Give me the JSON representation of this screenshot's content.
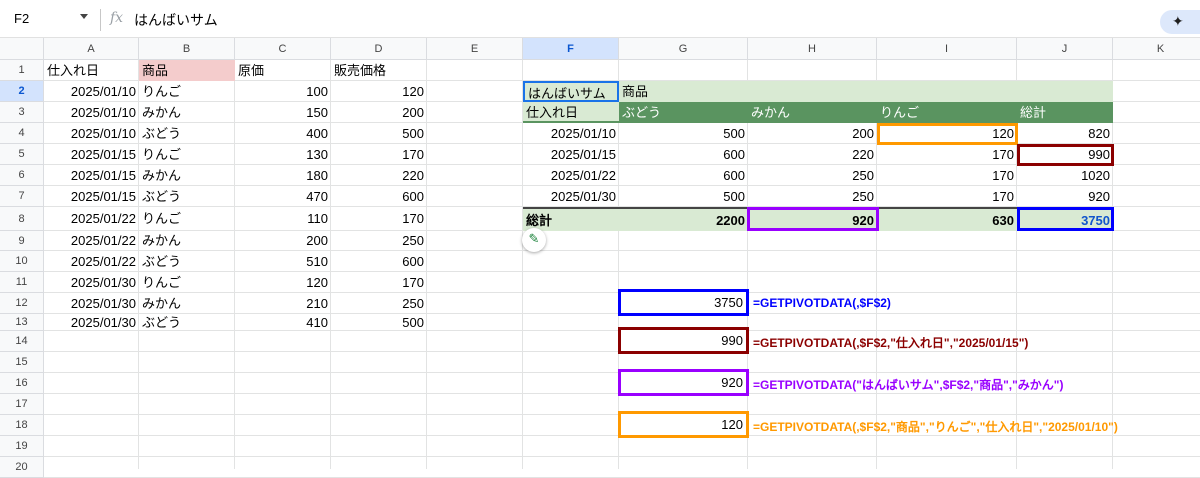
{
  "formula_bar": {
    "cell_ref": "F2",
    "fx_label": "fx",
    "content": "はんばいサム",
    "spark_icon": "✦"
  },
  "columns": [
    "A",
    "B",
    "C",
    "D",
    "E",
    "F",
    "G",
    "H",
    "I",
    "J",
    "K"
  ],
  "rows": [
    "1",
    "2",
    "3",
    "4",
    "5",
    "6",
    "7",
    "8",
    "9",
    "10",
    "11",
    "12",
    "13",
    "14",
    "15",
    "16",
    "17",
    "18",
    "19",
    "20"
  ],
  "source_table": {
    "headers": [
      "仕入れ日",
      "商品",
      "原価",
      "販売価格"
    ],
    "rows": [
      [
        "2025/01/10",
        "りんご",
        "100",
        "120"
      ],
      [
        "2025/01/10",
        "みかん",
        "150",
        "200"
      ],
      [
        "2025/01/10",
        "ぶどう",
        "400",
        "500"
      ],
      [
        "2025/01/15",
        "りんご",
        "130",
        "170"
      ],
      [
        "2025/01/15",
        "みかん",
        "180",
        "220"
      ],
      [
        "2025/01/15",
        "ぶどう",
        "470",
        "600"
      ],
      [
        "2025/01/22",
        "りんご",
        "110",
        "170"
      ],
      [
        "2025/01/22",
        "みかん",
        "200",
        "250"
      ],
      [
        "2025/01/22",
        "ぶどう",
        "510",
        "600"
      ],
      [
        "2025/01/30",
        "りんご",
        "120",
        "170"
      ],
      [
        "2025/01/30",
        "みかん",
        "210",
        "250"
      ],
      [
        "2025/01/30",
        "ぶどう",
        "410",
        "500"
      ]
    ]
  },
  "pivot": {
    "name": "はんばいサム",
    "col_field": "商品",
    "row_field": "仕入れ日",
    "col_headers": [
      "ぶどう",
      "みかん",
      "りんご",
      "総計"
    ],
    "rows": [
      [
        "2025/01/10",
        "500",
        "200",
        "120",
        "820"
      ],
      [
        "2025/01/15",
        "600",
        "220",
        "170",
        "990"
      ],
      [
        "2025/01/22",
        "600",
        "250",
        "170",
        "1020"
      ],
      [
        "2025/01/30",
        "500",
        "250",
        "170",
        "920"
      ]
    ],
    "total_label": "総計",
    "totals": [
      "2200",
      "920",
      "630",
      "3750"
    ]
  },
  "results": [
    {
      "value": "3750",
      "formula": "=GETPIVOTDATA(,$F$2)",
      "color": "#0000ff"
    },
    {
      "value": "990",
      "formula": "=GETPIVOTDATA(,$F$2,\"仕入れ日\",\"2025/01/15\")",
      "color": "#8b0000"
    },
    {
      "value": "920",
      "formula": "=GETPIVOTDATA(\"はんばいサム\",$F$2,\"商品\",\"みかん\")",
      "color": "#9900ff"
    },
    {
      "value": "120",
      "formula": "=GETPIVOTDATA(,$F$2,\"商品\",\"りんご\",\"仕入れ日\",\"2025/01/10\")",
      "color": "#ff9900"
    }
  ],
  "colors": {
    "pivot_header_green": "#5a9460",
    "pivot_light_green": "#d9ead3",
    "selected_header": "#d3e3fd",
    "highlight_pink": "#f4cccc"
  },
  "icons": {
    "pencil": "✎"
  }
}
